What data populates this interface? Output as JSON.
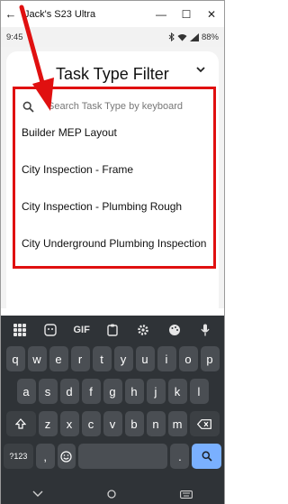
{
  "window": {
    "back_glyph": "←",
    "title": "Jack's S23 Ultra",
    "minimize_glyph": "—",
    "maximize_glyph": "☐",
    "close_glyph": "✕"
  },
  "status_bar": {
    "time": "9:45",
    "battery": "88%"
  },
  "filter": {
    "title": "Task Type Filter",
    "search_placeholder": "Search Task Type by keyboard",
    "items": [
      "Builder MEP Layout",
      "City Inspection - Frame",
      "City Inspection - Plumbing Rough",
      "City Underground Plumbing Inspection"
    ]
  },
  "annotation": {
    "highlight_color": "#e01010"
  },
  "keyboard": {
    "toolbar": {
      "gif_label": "GIF"
    },
    "row1": [
      "q",
      "w",
      "e",
      "r",
      "t",
      "y",
      "u",
      "i",
      "o",
      "p"
    ],
    "row2": [
      "a",
      "s",
      "d",
      "f",
      "g",
      "h",
      "j",
      "k",
      "l"
    ],
    "row3": [
      "z",
      "x",
      "c",
      "v",
      "b",
      "n",
      "m"
    ],
    "symbols_label": "?123",
    "comma_label": ",",
    "period_label": ".",
    "enter_color": "#7ab0ff"
  }
}
